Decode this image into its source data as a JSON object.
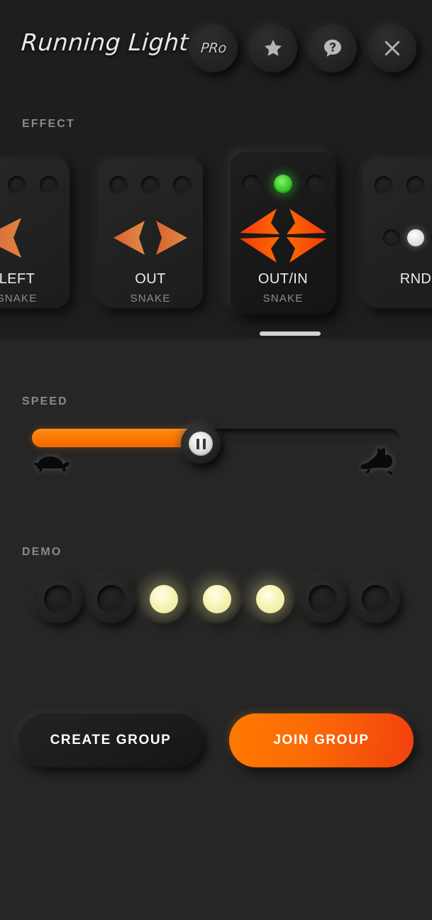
{
  "header": {
    "app_title": "Running Light",
    "buttons": [
      {
        "name": "pro-button",
        "label": "PRo",
        "icon": "pro-badge-icon"
      },
      {
        "name": "favorite-button",
        "label": "",
        "icon": "star-icon"
      },
      {
        "name": "help-button",
        "label": "",
        "icon": "question-bubble-icon"
      },
      {
        "name": "close-button",
        "label": "",
        "icon": "close-icon"
      }
    ]
  },
  "effect": {
    "section_label": "EFFECT",
    "cards": [
      {
        "name": "LEFT",
        "subtitle": "SNAKE",
        "art": "arrow-left",
        "selected": false,
        "leds": [
          0,
          0,
          0
        ]
      },
      {
        "name": "OUT",
        "subtitle": "SNAKE",
        "art": "arrows-out",
        "selected": false,
        "leds": [
          0,
          0,
          0
        ]
      },
      {
        "name": "OUT/IN",
        "subtitle": "SNAKE",
        "art": "arrows-outin",
        "selected": true,
        "leds": [
          0,
          1,
          0
        ]
      },
      {
        "name": "RND",
        "subtitle": "",
        "art": "random-dots",
        "selected": false,
        "leds": [
          0,
          0,
          0
        ]
      }
    ],
    "selected_index": 2,
    "scroll_position_pct": 70
  },
  "speed": {
    "section_label": "SPEED",
    "value_pct": 46,
    "state_icon": "pause-icon",
    "min_icon": "turtle-icon",
    "max_icon": "rabbit-icon"
  },
  "demo": {
    "section_label": "DEMO",
    "led_count": 7,
    "leds": [
      false,
      false,
      true,
      true,
      true,
      false,
      false
    ]
  },
  "actions": {
    "create_group_label": "CREATE GROUP",
    "join_group_label": "JOIN GROUP"
  },
  "colors": {
    "accent_orange": "#ff7a00",
    "accent_orange_deep": "#f2400f",
    "led_green": "#3fd132",
    "led_yellow": "#f6f3b4",
    "panel_dark": "#1e1e1e",
    "panel_base": "#262626",
    "text_primary": "#ededed",
    "text_muted": "#8a8a8a"
  }
}
